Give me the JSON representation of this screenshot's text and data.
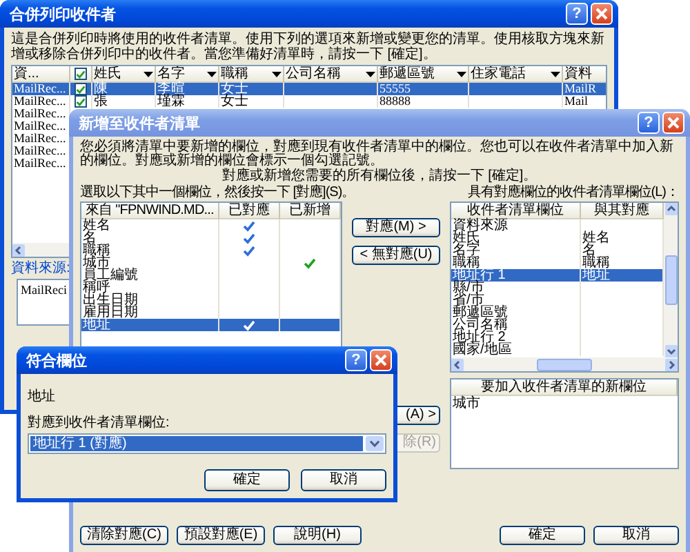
{
  "recipients_window": {
    "title": "合併列印收件者",
    "active": true,
    "help_label": "?",
    "instructions": "這是合併列印時將使用的收件者清單。使用下列的選項來新增或變更您的清單。使用核取方塊來新增或移除合併列印中的收件者。當您準備好清單時，請按一下 [確定]。",
    "columns": [
      {
        "label": "資...",
        "kind": "plain"
      },
      {
        "kind": "checkbox",
        "checked": true
      },
      {
        "label": "姓氏",
        "kind": "sortable"
      },
      {
        "label": "名字",
        "kind": "sortable"
      },
      {
        "label": "職稱",
        "kind": "sortable"
      },
      {
        "label": "公司名稱",
        "kind": "sortable"
      },
      {
        "label": "郵遞區號",
        "kind": "sortable"
      },
      {
        "label": "住家電話",
        "kind": "sortable"
      },
      {
        "label": "資料",
        "kind": "plain"
      }
    ],
    "rows": [
      {
        "source": "MailRec...",
        "checked": true,
        "selected": true,
        "cells": [
          "陳",
          "李暄",
          "女士",
          "",
          "55555",
          "",
          "MailR"
        ]
      },
      {
        "source": "MailRec...",
        "checked": true,
        "selected": false,
        "cells": [
          "張",
          "瑾霖",
          "女士",
          "",
          "88888",
          "",
          "Mail"
        ]
      },
      {
        "source": "MailRec...",
        "selected": false
      },
      {
        "source": "MailRec...",
        "selected": false
      },
      {
        "source": "MailRec...",
        "selected": false
      },
      {
        "source": "MailRec...",
        "selected": false
      },
      {
        "source": "MailRec...",
        "selected": false
      }
    ],
    "data_source_label": "資料來源:",
    "data_source_value": "MailReci"
  },
  "add_window": {
    "title": "新增至收件者清單",
    "active": false,
    "help_label": "?",
    "instructions": "您必須將清單中要新增的欄位，對應到現有收件者清單中的欄位。您也可以在收件者清單中加入新的欄位。對應或新增的欄位會標示一個勾選記號。",
    "hint": "對應或新增您需要的所有欄位後，請按一下 [確定]。",
    "left_label": "選取以下其中一個欄位，然後按一下 [對應](S)。",
    "left_columns": [
      "來自 \"FPNWIND.MD...",
      "已對應",
      "已新增"
    ],
    "left_rows": [
      {
        "name": "姓名",
        "mapped": true,
        "added": false,
        "selected": false
      },
      {
        "name": "名",
        "mapped": true,
        "added": false,
        "selected": false
      },
      {
        "name": "職稱",
        "mapped": true,
        "added": false,
        "selected": false
      },
      {
        "name": "城市",
        "mapped": false,
        "added": true,
        "selected": false
      },
      {
        "name": "員工編號",
        "mapped": false,
        "added": false,
        "selected": false
      },
      {
        "name": "稱呼",
        "mapped": false,
        "added": false,
        "selected": false
      },
      {
        "name": "出生日期",
        "mapped": false,
        "added": false,
        "selected": false
      },
      {
        "name": "雇用日期",
        "mapped": false,
        "added": false,
        "selected": false
      },
      {
        "name": "地址",
        "mapped": true,
        "added": false,
        "selected": true
      }
    ],
    "map_buttons": [
      {
        "label": "對應(M) >",
        "disabled": false
      },
      {
        "label": "< 無對應(U)",
        "disabled": false
      }
    ],
    "list_buttons": [
      {
        "label": "(A) >",
        "disabled": false
      },
      {
        "label": "除(R)",
        "disabled": true
      }
    ],
    "right_label": "具有對應欄位的收件者清單欄位(L)：",
    "right_columns": [
      "收件者清單欄位",
      "與其對應"
    ],
    "right_rows": [
      {
        "field": "資料來源",
        "mapped_to": "",
        "selected": false
      },
      {
        "field": "姓氏",
        "mapped_to": "姓名",
        "selected": false
      },
      {
        "field": "名字",
        "mapped_to": "名",
        "selected": false
      },
      {
        "field": "職稱",
        "mapped_to": "職稱",
        "selected": false
      },
      {
        "field": "地址行 1",
        "mapped_to": "地址",
        "selected": true
      },
      {
        "field": "縣/市",
        "mapped_to": "",
        "selected": false
      },
      {
        "field": "省/市",
        "mapped_to": "",
        "selected": false
      },
      {
        "field": "郵遞區號",
        "mapped_to": "",
        "selected": false
      },
      {
        "field": "公司名稱",
        "mapped_to": "",
        "selected": false
      },
      {
        "field": "地址行 2",
        "mapped_to": "",
        "selected": false
      },
      {
        "field": "國家/地區",
        "mapped_to": "",
        "selected": false
      }
    ],
    "new_fields_header": "要加入收件者清單的新欄位",
    "new_fields": [
      "城市"
    ],
    "footer_left": [
      "清除對應(C)",
      "預設對應(E)",
      "說明(H)"
    ],
    "footer_right": [
      "確定",
      "取消"
    ]
  },
  "match_window": {
    "title": "符合欄位",
    "active": true,
    "help_label": "?",
    "field": "地址",
    "select_label": "對應到收件者清單欄位:",
    "select_value": "地址行 1 (對應)",
    "buttons": [
      "確定",
      "取消"
    ]
  }
}
